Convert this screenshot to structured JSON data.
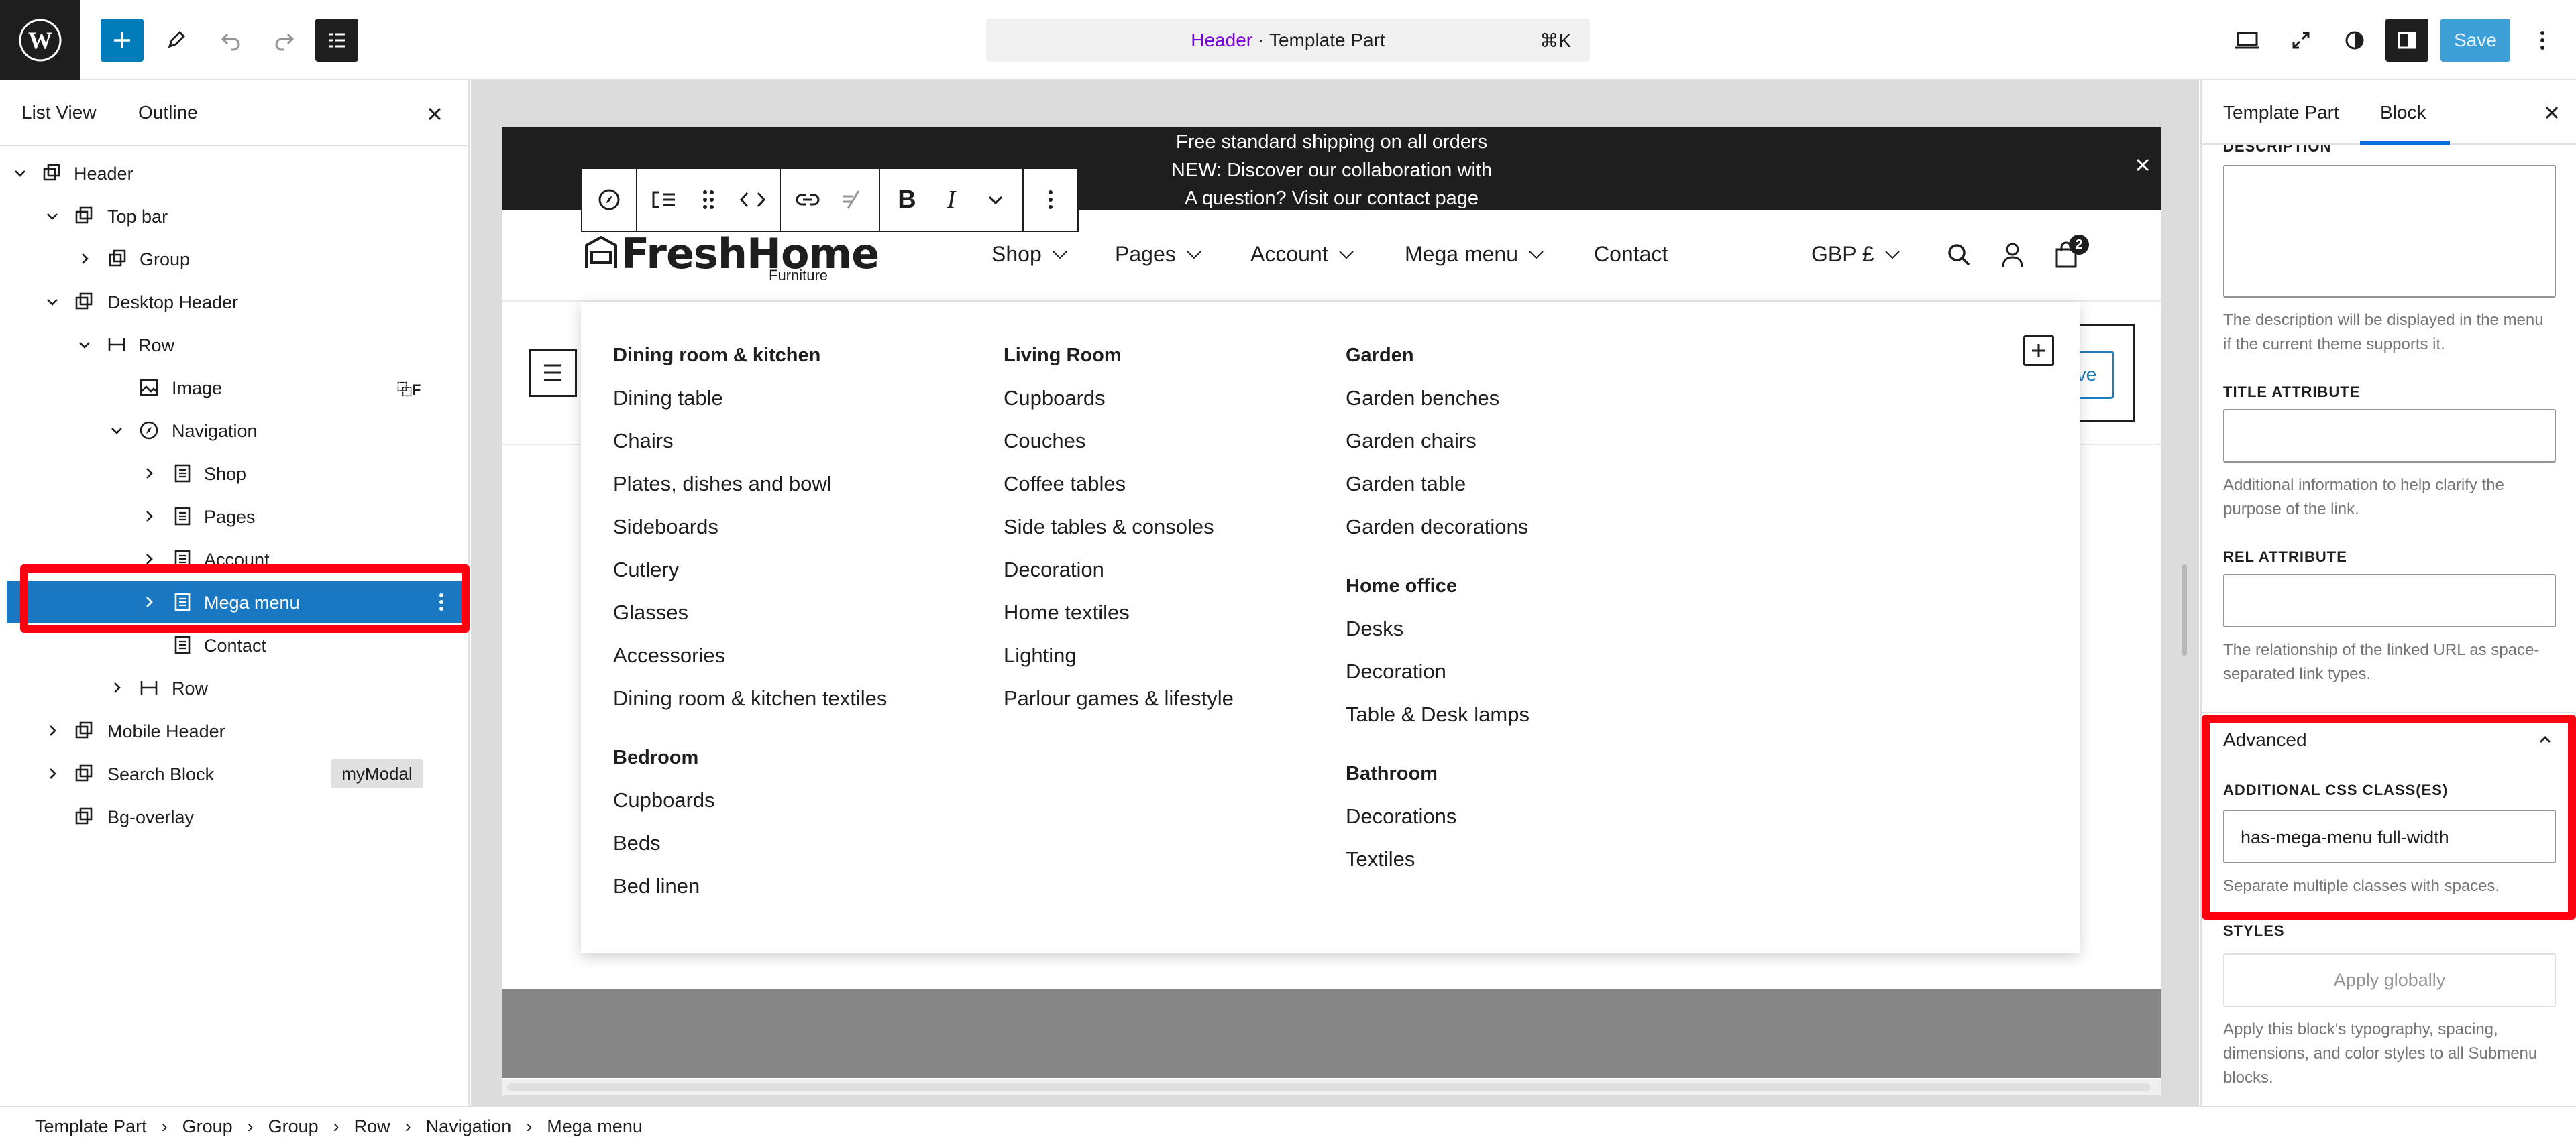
{
  "topbar": {
    "doc_title_part": "Header",
    "doc_title_sep": " · ",
    "doc_title_type": "Template Part",
    "shortcut": "⌘K",
    "save_label": "Save"
  },
  "left_panel": {
    "tab_list_view": "List View",
    "tab_outline": "Outline",
    "tree": [
      {
        "label": "Header"
      },
      {
        "label": "Top bar"
      },
      {
        "label": "Group"
      },
      {
        "label": "Desktop Header"
      },
      {
        "label": "Row"
      },
      {
        "label": "Image",
        "badge": "⿻F"
      },
      {
        "label": "Navigation"
      },
      {
        "label": "Shop"
      },
      {
        "label": "Pages"
      },
      {
        "label": "Account"
      },
      {
        "label": "Mega menu"
      },
      {
        "label": "Contact"
      },
      {
        "label": "Row"
      },
      {
        "label": "Mobile Header"
      },
      {
        "label": "Search Block",
        "badge": "myModal"
      },
      {
        "label": "Bg-overlay"
      }
    ]
  },
  "canvas": {
    "announcement": [
      "Free standard shipping on all orders",
      "NEW: Discover our collaboration with",
      "A question? Visit our contact page"
    ],
    "logo": {
      "name": "FreshHome",
      "sub": "Furniture"
    },
    "nav": [
      "Shop",
      "Pages",
      "Account",
      "Mega menu",
      "Contact"
    ],
    "currency": "GBP £",
    "cart_count": "2",
    "right_button_text": "ve",
    "mega_menu": {
      "col1": {
        "head1": "Dining room & kitchen",
        "links1": [
          "Dining table",
          "Chairs",
          "Plates, dishes and bowl",
          "Sideboards",
          "Cutlery",
          "Glasses",
          "Accessories",
          "Dining room & kitchen textiles"
        ],
        "head2": "Bedroom",
        "links2": [
          "Cupboards",
          "Beds",
          "Bed linen"
        ]
      },
      "col2": {
        "head1": "Living Room",
        "links1": [
          "Cupboards",
          "Couches",
          "Coffee tables",
          "Side tables & consoles",
          "Decoration",
          "Home textiles",
          "Lighting",
          "Parlour games & lifestyle"
        ]
      },
      "col3": {
        "head1": "Garden",
        "links1": [
          "Garden benches",
          "Garden chairs",
          "Garden table",
          "Garden decorations"
        ],
        "head2": "Home office",
        "links2": [
          "Desks",
          "Decoration",
          "Table & Desk lamps"
        ],
        "head3": "Bathroom",
        "links3": [
          "Decorations",
          "Textiles"
        ]
      }
    }
  },
  "right_panel": {
    "tab_template_part": "Template Part",
    "tab_block": "Block",
    "description_label": "DESCRIPTION",
    "description_help": "The description will be displayed in the menu if the current theme supports it.",
    "title_attr_label": "TITLE ATTRIBUTE",
    "title_attr_help": "Additional information to help clarify the purpose of the link.",
    "rel_attr_label": "REL ATTRIBUTE",
    "rel_attr_help": "The relationship of the linked URL as space-separated link types.",
    "advanced_label": "Advanced",
    "css_label": "ADDITIONAL CSS CLASS(ES)",
    "css_value": "has-mega-menu full-width",
    "css_help": "Separate multiple classes with spaces.",
    "styles_label": "STYLES",
    "apply_globally": "Apply globally",
    "styles_help": "Apply this block's typography, spacing, dimensions, and color styles to all Submenu blocks."
  },
  "breadcrumb": [
    "Template Part",
    "Group",
    "Group",
    "Row",
    "Navigation",
    "Mega menu"
  ],
  "colors": {
    "accent": "#007cba",
    "selected_row": "#1a78c2",
    "highlight_red": "#ff0010",
    "dark": "#1e1e1e"
  }
}
